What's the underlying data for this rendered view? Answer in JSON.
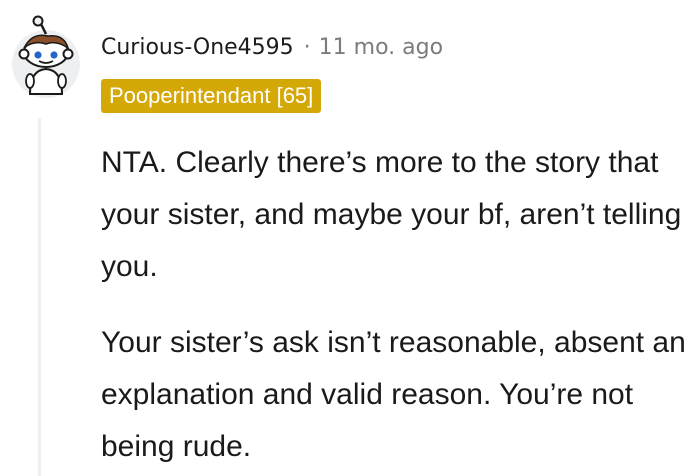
{
  "comment": {
    "author": "Curious-One4595",
    "separator": "·",
    "timestamp": "11 mo. ago",
    "flair": "Pooperintendant [65]",
    "flair_color": "#d4a807",
    "avatar_icon": "snoo-avatar-icon",
    "paragraphs": [
      "NTA. Clearly there’s more to the story that your sister, and maybe your bf, aren’t telling you.",
      "Your sister’s ask isn’t reasonable, absent an explanation and valid reason. You’re not being rude."
    ]
  }
}
